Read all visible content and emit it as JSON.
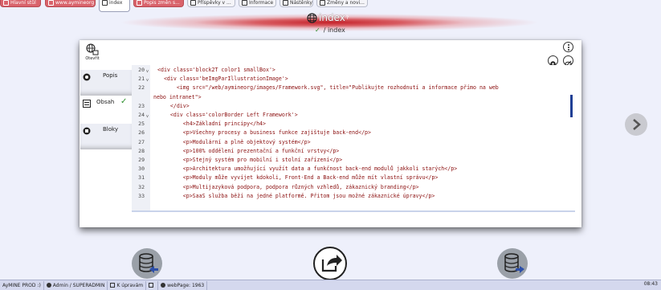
{
  "tabs": [
    {
      "label": "Hlavní stůl",
      "style": "red"
    },
    {
      "label": "www.aymineorg",
      "style": "red"
    },
    {
      "label": "index",
      "style": "active"
    },
    {
      "label": "Popis změn s...",
      "style": "red"
    },
    {
      "label": "Příspěvky v ...",
      "style": "normal"
    },
    {
      "label": "Informace",
      "style": "normal"
    },
    {
      "label": "Nástěnky",
      "style": "normal"
    },
    {
      "label": "Změny a novi...",
      "style": "normal"
    }
  ],
  "header": {
    "title": "index",
    "title_sup": "?",
    "breadcrumb_check": "✓",
    "breadcrumb": "/ index"
  },
  "card": {
    "open_label": "Otevřít",
    "nav": [
      {
        "label": "Popis",
        "active": false
      },
      {
        "label": "Obsah",
        "active": true,
        "check": "✓"
      },
      {
        "label": "Bloky",
        "active": false
      }
    ]
  },
  "editor": {
    "lines": [
      {
        "n": "20",
        "fold": "v",
        "text": "<div class='block2T color1 smallBox'>"
      },
      {
        "n": "21",
        "fold": "v",
        "text": "  <div class='beImgParIllustrationImage'>"
      },
      {
        "n": "22",
        "fold": "",
        "text": "      <img src=\"/web/aymineorg/images/Framework.svg\", title=\"Publikujte rozhodnutí a informace přímo na web"
      },
      {
        "n": "",
        "fold": "",
        "text": "nebo intranet\">",
        "wrap": true
      },
      {
        "n": "23",
        "fold": "",
        "text": "    </div>"
      },
      {
        "n": "24",
        "fold": "v",
        "text": "    <div class='colorBorder Left Framework'>"
      },
      {
        "n": "25",
        "fold": "",
        "text": "        <h4>Základní principy</h4>"
      },
      {
        "n": "26",
        "fold": "",
        "text": "        <p>Všechny procesy a business funkce zajištuje back-end</p>"
      },
      {
        "n": "27",
        "fold": "",
        "text": "        <p>Modulární a plně objektový systém</p>"
      },
      {
        "n": "28",
        "fold": "",
        "text": "        <p>100% oddělení prezentační a funkční vrstvy</p>"
      },
      {
        "n": "29",
        "fold": "",
        "text": "        <p>Stejný systém pro mobilní i stolní zařízení</p>"
      },
      {
        "n": "30",
        "fold": "",
        "text": "        <p>Architektura umožňující využít data a funkčnost back-end modulů jakkoli starých</p>"
      },
      {
        "n": "31",
        "fold": "",
        "text": "        <p>Moduly může vyvíjet kdokoli, Front-End a Back-end může mít vlastní správu</p>"
      },
      {
        "n": "32",
        "fold": "",
        "text": "        <p>Multijazyková podpora, podpora různých vzhledů, zákaznický branding</p>"
      },
      {
        "n": "33",
        "fold": "",
        "text": "        <p>SaaS služba běží na jedné platformě. Přitom jsou možné zákaznické úpravy</p>"
      }
    ]
  },
  "statusbar": {
    "app": "AyMINE PROD :)",
    "user": "Admin / SUPERADMIN",
    "edit": "K úpravám",
    "webpage": "webPage: 1963",
    "time": "08:43"
  },
  "colors": {
    "accent_red": "#c5222a",
    "code_text": "#8b0f0f",
    "code_blue": "#1f3f95",
    "check_green": "#2b8f2b"
  }
}
